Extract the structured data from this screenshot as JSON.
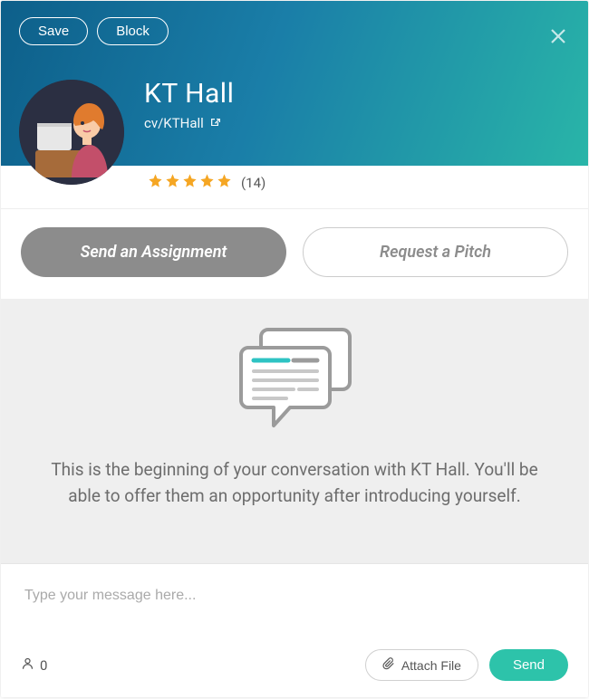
{
  "header": {
    "save_label": "Save",
    "block_label": "Block"
  },
  "profile": {
    "name": "KT Hall",
    "link_text": "cv/KTHall",
    "stars": 5,
    "rating_count": "(14)"
  },
  "actions": {
    "assignment_label": "Send an Assignment",
    "pitch_label": "Request a Pitch"
  },
  "conversation": {
    "empty_message": "This is the beginning of your conversation with KT Hall. You'll be able to offer them an opportunity after introducing yourself."
  },
  "compose": {
    "placeholder": "Type your message here...",
    "recipient_count": "0",
    "attach_label": "Attach File",
    "send_label": "Send"
  }
}
